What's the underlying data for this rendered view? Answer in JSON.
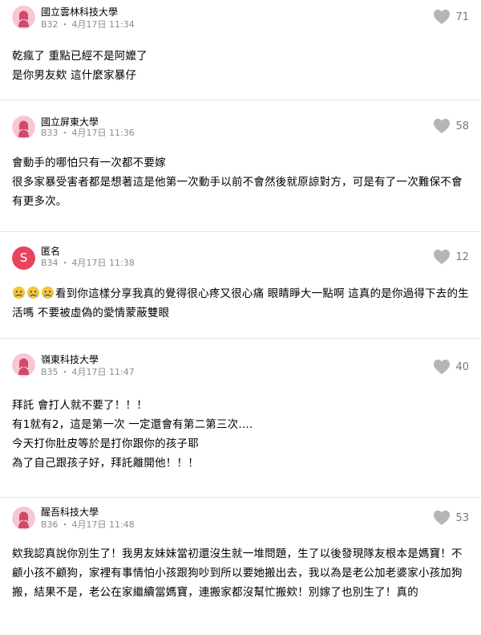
{
  "comments": [
    {
      "school": "國立雲林科技大學",
      "floor": "B32",
      "sep": "・",
      "time": "4月17日 11:34",
      "likes": "71",
      "avatar": "female-avatar",
      "lines": [
        "乾瘋了 重點已經不是阿嬤了",
        "是你男友欸 這什麼家暴仔"
      ]
    },
    {
      "school": "國立屏東大學",
      "floor": "B33",
      "sep": "・",
      "time": "4月17日 11:36",
      "likes": "58",
      "avatar": "female-avatar",
      "lines": [
        "會動手的哪怕只有一次都不要嫁",
        "很多家暴受害者都是想著這是他第一次動手以前不會然後就原諒對方，可是有了一次難保不會有更多次。"
      ]
    },
    {
      "school": "匿名",
      "floor": "B34",
      "sep": "・",
      "time": "4月17日 11:38",
      "likes": "12",
      "avatar_letter": "S",
      "emoji": [
        "crying-face-emoji",
        "crying-face-emoji",
        "crying-face-emoji"
      ],
      "lines": [
        "看到你這樣分享我真的覺得很心疼又很心痛 眼睛睜大一點啊 這真的是你過得下去的生活嗎 不要被虛偽的愛情蒙蔽雙眼"
      ]
    },
    {
      "school": "嶺東科技大學",
      "floor": "B35",
      "sep": "・",
      "time": "4月17日 11:47",
      "likes": "40",
      "avatar": "female-avatar",
      "lines": [
        "拜託 會打人就不要了！！！",
        "有1就有2，這是第一次 一定還會有第二第三次....",
        "今天打你肚皮等於是打你跟你的孩子耶",
        "為了自己跟孩子好，拜託離開他！！！"
      ]
    },
    {
      "school": "醒吾科技大學",
      "floor": "B36",
      "sep": "・",
      "time": "4月17日 11:48",
      "likes": "53",
      "avatar": "female-avatar",
      "lines": [
        "欸我認真說你別生了！我男友妹妹當初還沒生就一堆問題，生了以後發現隊友根本是媽寶！不顧小孩不顧狗，家裡有事情怕小孩跟狗吵到所以要她搬出去，我以為是老公加老婆家小孩加狗搬，結果不是，老公在家繼續當媽寶，連搬家都沒幫忙搬欸！別嫁了也別生了！真的"
      ]
    }
  ],
  "colors": {
    "avatar_pink": "#f7c7d3",
    "avatar_figure": "#d04a6a",
    "anon_red": "#e8445e",
    "like_gray": "#b5b5b5",
    "meta_gray": "#8c8c8c"
  }
}
